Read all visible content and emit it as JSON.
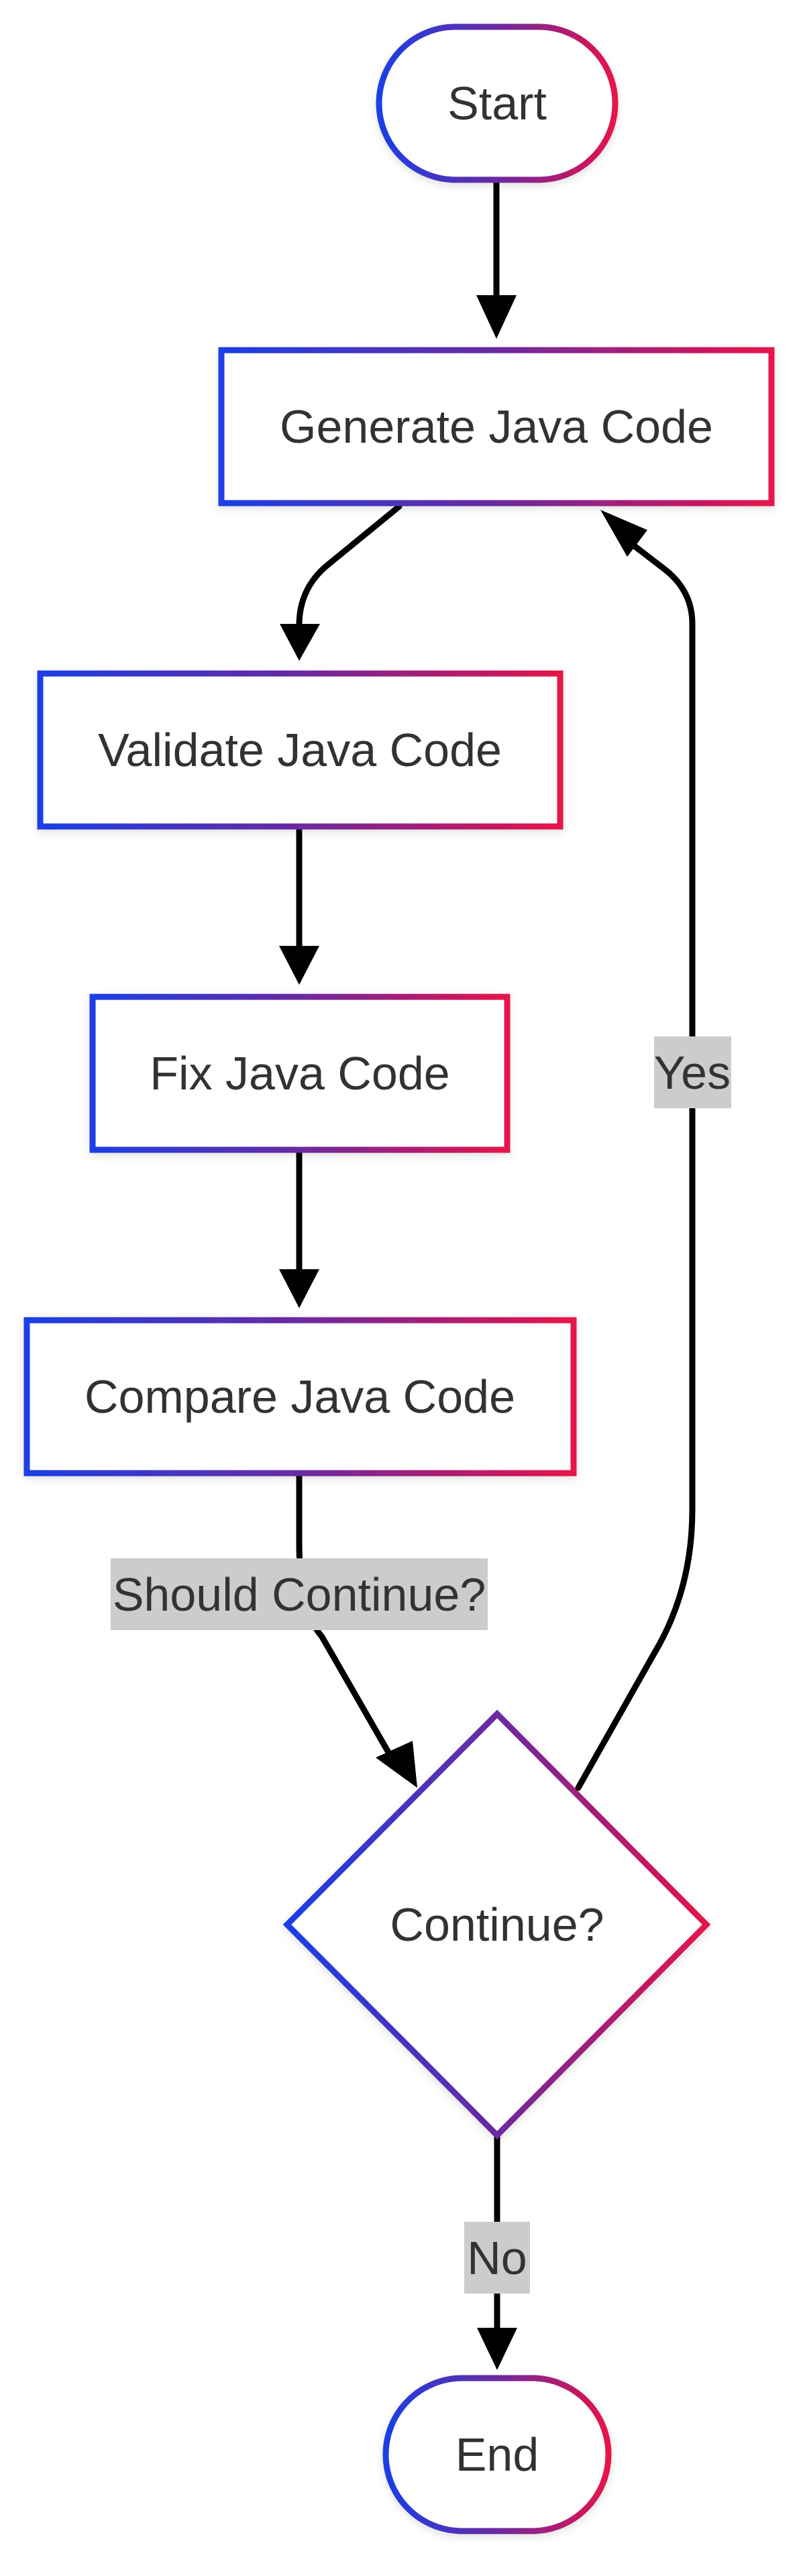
{
  "nodes": {
    "start": "Start",
    "generate": "Generate Java Code",
    "validate": "Validate Java Code",
    "fix": "Fix Java Code",
    "compare": "Compare Java Code",
    "decision": "Continue?",
    "end": "End"
  },
  "edges": {
    "compare_to_decision": "Should Continue?",
    "decision_yes": "Yes",
    "decision_no": "No"
  },
  "colors": {
    "node_gradient_start": "#1a3fe6",
    "node_gradient_mid": "#6a2aa0",
    "node_gradient_end": "#e6124a",
    "edge_stroke": "#000000",
    "edge_label_bg": "#cccccc",
    "text": "#333333"
  }
}
